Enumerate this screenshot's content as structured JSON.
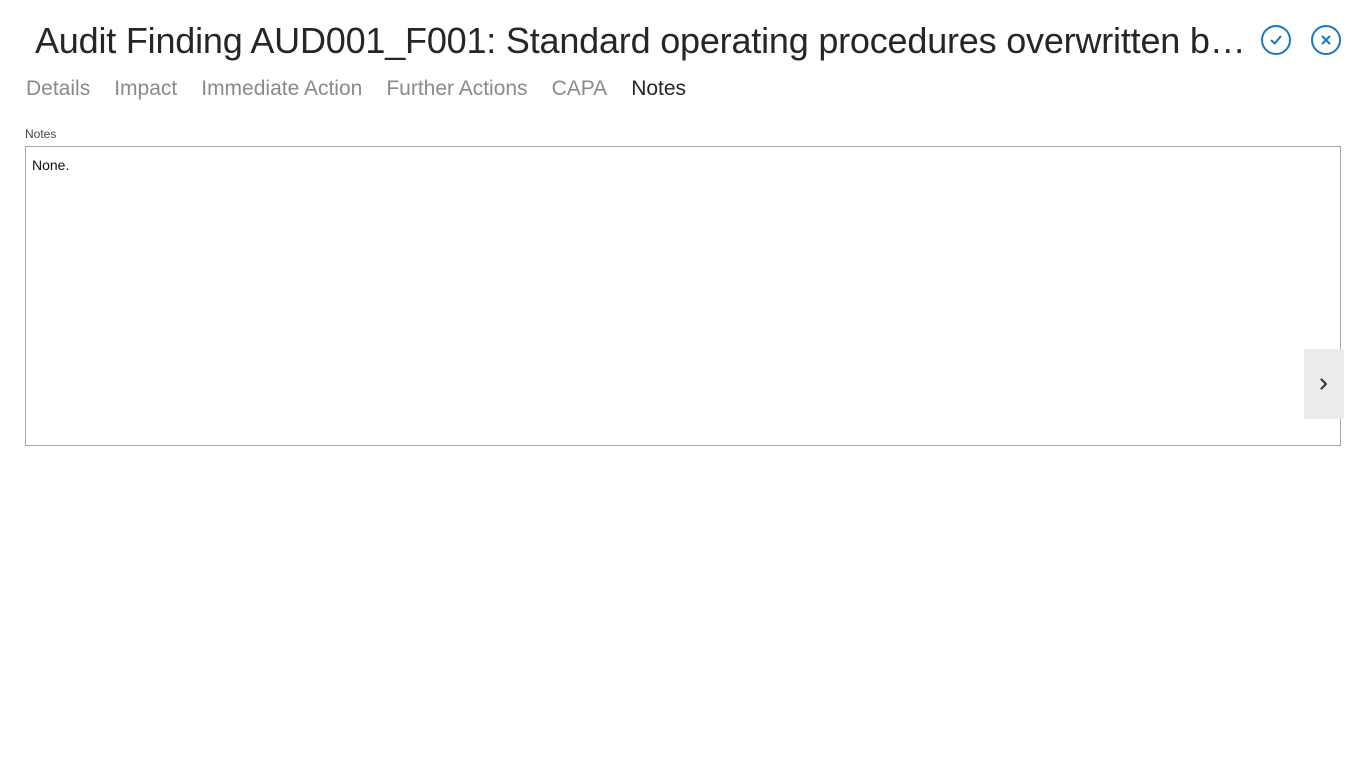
{
  "header": {
    "title": "Audit Finding AUD001_F001: Standard operating procedures overwritten but not…",
    "accent_color": "#1a78c2"
  },
  "actions": {
    "save_icon": "checkmark-circle-icon",
    "close_icon": "close-circle-icon"
  },
  "tabs": [
    {
      "label": "Details",
      "active": false
    },
    {
      "label": "Impact",
      "active": false
    },
    {
      "label": "Immediate Action",
      "active": false
    },
    {
      "label": "Further Actions",
      "active": false
    },
    {
      "label": "CAPA",
      "active": false
    },
    {
      "label": "Notes",
      "active": true
    }
  ],
  "notes_field": {
    "label": "Notes",
    "value": "None."
  },
  "navigation": {
    "next_icon": "chevron-right-icon"
  }
}
